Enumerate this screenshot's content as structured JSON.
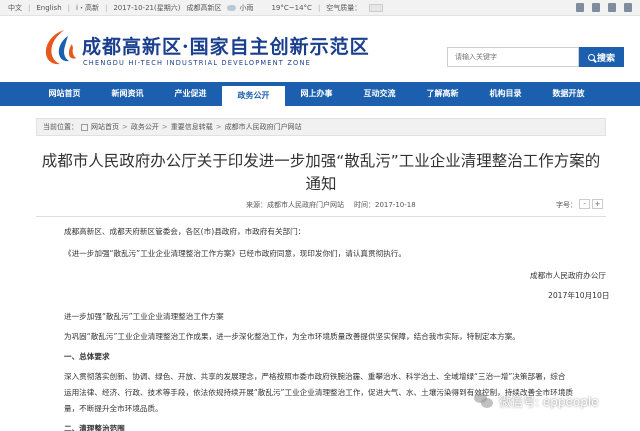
{
  "topbar": {
    "lang_cn": "中文",
    "lang_en": "English",
    "mobile": "i・高新",
    "date": "2017-10-21(星期六)",
    "location": "成都高新区",
    "weather": "小雨",
    "temp": "19°C~14°C",
    "air_quality": "空气质量："
  },
  "header": {
    "logo_cn": "成都高新区·国家自主创新示范区",
    "logo_en": "CHENGDU HI-TECH INDUSTRIAL DEVELOPMENT ZONE",
    "search_placeholder": "请输入关键字",
    "search_label": "搜索",
    "brand_color": "#1b5fae"
  },
  "nav": {
    "items": [
      "网站首页",
      "新闻资讯",
      "产业促进",
      "政务公开",
      "网上办事",
      "互动交流",
      "了解高新",
      "机构目录",
      "数据开放"
    ],
    "active_index": 3
  },
  "breadcrumb": {
    "prefix": "当前位置：",
    "items": [
      "网站首页",
      "政务公开",
      "重要信息转载",
      "成都市人民政府门户网站"
    ]
  },
  "article": {
    "title_line1": "成都市人民政府办公厅关于印发进一步加强“散乱污”工业企业清理整治工作方案的",
    "title_line2": "通知",
    "source_label": "来源：",
    "source": "成都市人民政府门户网站",
    "time_label": "时间：",
    "time": "2017-10-18",
    "font_size_label": "字号：",
    "font_minus": "-",
    "font_plus": "+",
    "p1": "成都高新区、成都天府新区管委会，各区(市)县政府，市政府有关部门：",
    "p2": "《进一步加强“散乱污”工业企业清理整治工作方案》已经市政府同意，现印发你们，请认真贯彻执行。",
    "sign_org": "成都市人民政府办公厅",
    "sign_date": "2017年10月10日",
    "doc_title": "进一步加强“散乱污”工业企业清理整治工作方案",
    "p3": "为巩固“散乱污”工业企业清理整治工作成果，进一步深化整治工作，为全市环境质量改善提供坚实保障，结合我市实际，特制定本方案。",
    "h1": "一、总体要求",
    "p4_l1": "深入贯彻落实创新、协调、绿色、开放、共享的发展理念，严格按照市委市政府铁腕治霾、重攀治水、科学治土、全域增绿“三治一增”决策部署，综合",
    "p4_l2": "运用法律、经济、行政、技术等手段，依法依规持续开展“散乱污”工业企业清理整治工作，促进大气、水、土壤污染得到有效控制，持续改善全市环境质",
    "p4_l3": "量，不断提升全市环境品质。",
    "h2": "二、清理整治范围"
  },
  "watermark": {
    "text": "微信号: eppeople"
  }
}
